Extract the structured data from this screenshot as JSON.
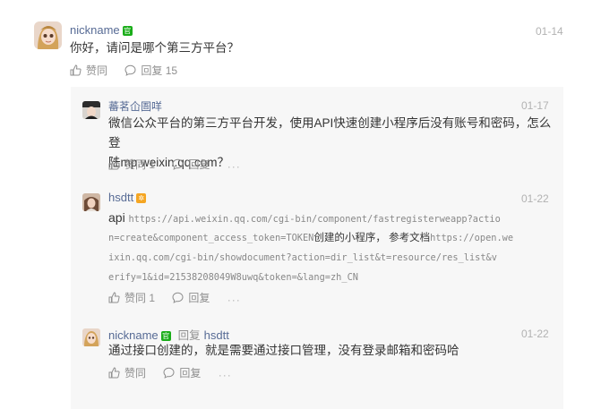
{
  "comment": {
    "nickname": "nickname",
    "badge": "官",
    "date": "01-14",
    "text": "你好，请问是哪个第三方平台？",
    "like_label": "赞同",
    "reply_label": "回复",
    "reply_count": "15"
  },
  "replies": [
    {
      "nickname": "蕃茗仚圄咩",
      "date": "01-17",
      "text_line1": "微信公众平台的第三方平台开发，使用API快速创建小程序后没有账号和密码，怎么登",
      "text_line2": "陆mp.weixin.qq.com？",
      "like_label": "赞同",
      "like_count": "1",
      "reply_label": "回复",
      "more": "···"
    },
    {
      "nickname": "hsdtt",
      "badge": "✲",
      "date": "01-22",
      "text_api": "api",
      "line1_url": "https://api.weixin.qq.com/cgi-bin/component/fastregisterweapp?actio",
      "line2_url": "n=create&component_access_token=TOKEN",
      "line2_text": "创建的小程序， 参考文档",
      "line2_url2": "https://open.we",
      "line3_url": "ixin.qq.com/cgi-bin/showdocument?action=dir_list&t=resource/res_list&v",
      "line4_url": "erify=1&id=21538208049W8uwq&token=&lang=zh_CN",
      "like_label": "赞同",
      "like_count": "1",
      "reply_label": "回复",
      "more": "···"
    },
    {
      "nickname": "nickname",
      "badge": "官",
      "reply_word": "回复",
      "reply_to": "hsdtt",
      "date": "01-22",
      "text": "通过接口创建的，就是需要通过接口管理，没有登录邮箱和密码哈",
      "like_label": "赞同",
      "reply_label": "回复",
      "more": "···"
    }
  ],
  "colors": {
    "nickname": "#576b95",
    "meta": "#b2b2b2",
    "reply_bg": "#f7f7f7",
    "badge_green": "#1aad19",
    "badge_orange": "#f5a623"
  },
  "icons": [
    "thumbs-up-icon",
    "comment-icon",
    "more-icon"
  ]
}
